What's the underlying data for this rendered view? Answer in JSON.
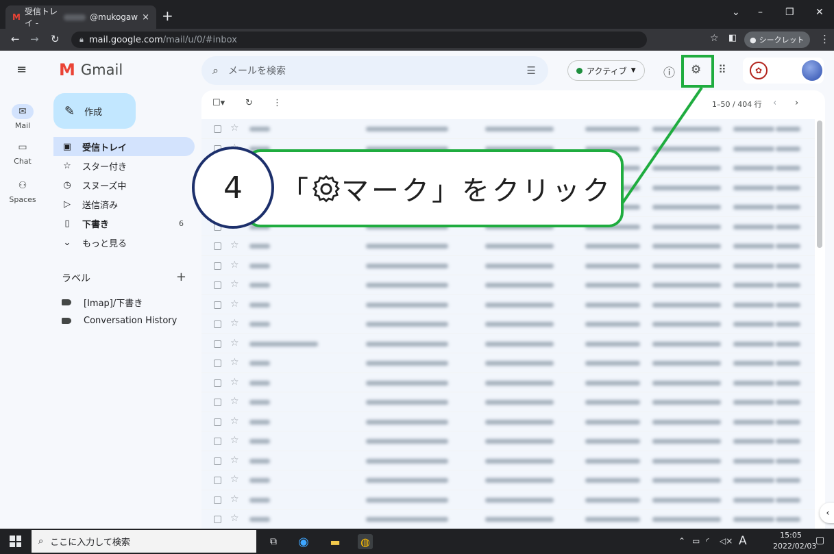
{
  "browser": {
    "tab_title_prefix": "受信トレイ -",
    "tab_title_suffix": "@mukogaw",
    "tab_close": "×",
    "new_tab": "+",
    "url_host": "mail.google.com",
    "url_path": "/mail/u/0/#inbox",
    "incognito_label": "シークレット",
    "win_minimize": "–",
    "win_restore": "❐",
    "win_close": "✕",
    "win_menu": "⌄"
  },
  "gmail": {
    "app_name": "Gmail",
    "search_placeholder": "メールを検索",
    "status_label": "アクティブ",
    "compose_label": "作成",
    "rail": [
      {
        "label": "Mail"
      },
      {
        "label": "Chat"
      },
      {
        "label": "Spaces"
      }
    ],
    "nav": [
      {
        "label": "受信トレイ",
        "icon": "inbox-icon",
        "glyph": "▣",
        "count": ""
      },
      {
        "label": "スター付き",
        "icon": "star-icon",
        "glyph": "☆",
        "count": ""
      },
      {
        "label": "スヌーズ中",
        "icon": "clock-icon",
        "glyph": "◷",
        "count": ""
      },
      {
        "label": "送信済み",
        "icon": "send-icon",
        "glyph": "▷",
        "count": ""
      },
      {
        "label": "下書き",
        "icon": "draft-icon",
        "glyph": "▯",
        "count": "6"
      },
      {
        "label": "もっと見る",
        "icon": "chevron-down-icon",
        "glyph": "⌄",
        "count": ""
      }
    ],
    "labels_heading": "ラベル",
    "labels": [
      "[Imap]/下書き",
      "Conversation History"
    ],
    "page_info": "1–50 / 404 行"
  },
  "callout": {
    "step_number": "4",
    "text_open": "「",
    "text_rest": "マーク」をクリック",
    "highlight_color": "#1fac3f"
  },
  "taskbar": {
    "search_placeholder": "ここに入力して検索",
    "time": "15:05",
    "date": "2022/02/03",
    "ime": "A"
  }
}
